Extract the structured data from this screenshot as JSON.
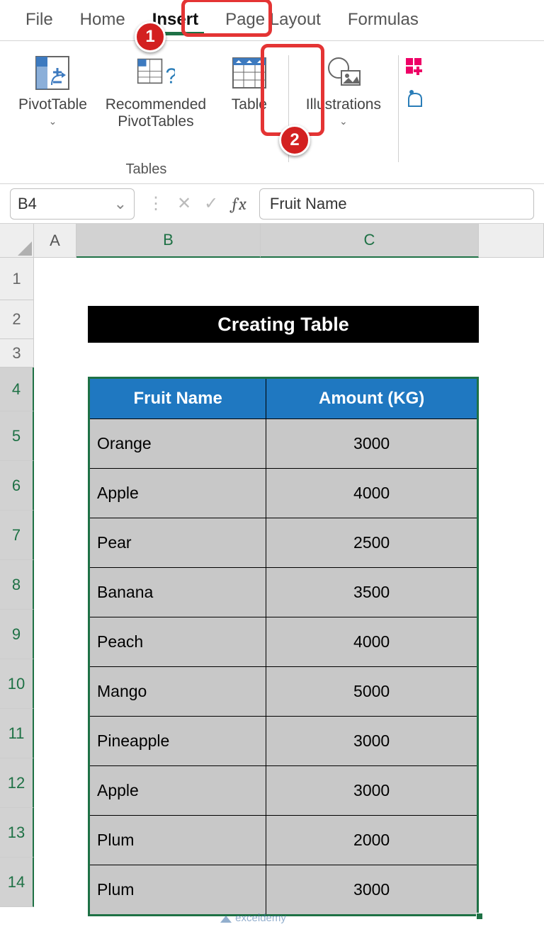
{
  "tabs": {
    "file": "File",
    "home": "Home",
    "insert": "Insert",
    "page_layout": "Page Layout",
    "formulas": "Formulas"
  },
  "ribbon": {
    "pivot_table": "PivotTable",
    "recommended_pt": "Recommended\nPivotTables",
    "table": "Table",
    "illustrations": "Illustrations",
    "group_tables": "Tables"
  },
  "namebox": "B4",
  "fx_value": "Fruit Name",
  "colA": "A",
  "colB": "B",
  "colC": "C",
  "title": "Creating Table",
  "headers": {
    "fruit": "Fruit Name",
    "amount": "Amount (KG)"
  },
  "rows": [
    {
      "fruit": "Orange",
      "amount": "3000"
    },
    {
      "fruit": "Apple",
      "amount": "4000"
    },
    {
      "fruit": "Pear",
      "amount": "2500"
    },
    {
      "fruit": "Banana",
      "amount": "3500"
    },
    {
      "fruit": "Peach",
      "amount": "4000"
    },
    {
      "fruit": "Mango",
      "amount": "5000"
    },
    {
      "fruit": "Pineapple",
      "amount": "3000"
    },
    {
      "fruit": "Apple",
      "amount": "3000"
    },
    {
      "fruit": "Plum",
      "amount": "2000"
    },
    {
      "fruit": "Plum",
      "amount": "3000"
    }
  ],
  "badges": {
    "one": "1",
    "two": "2"
  },
  "watermark": "exceldemy"
}
